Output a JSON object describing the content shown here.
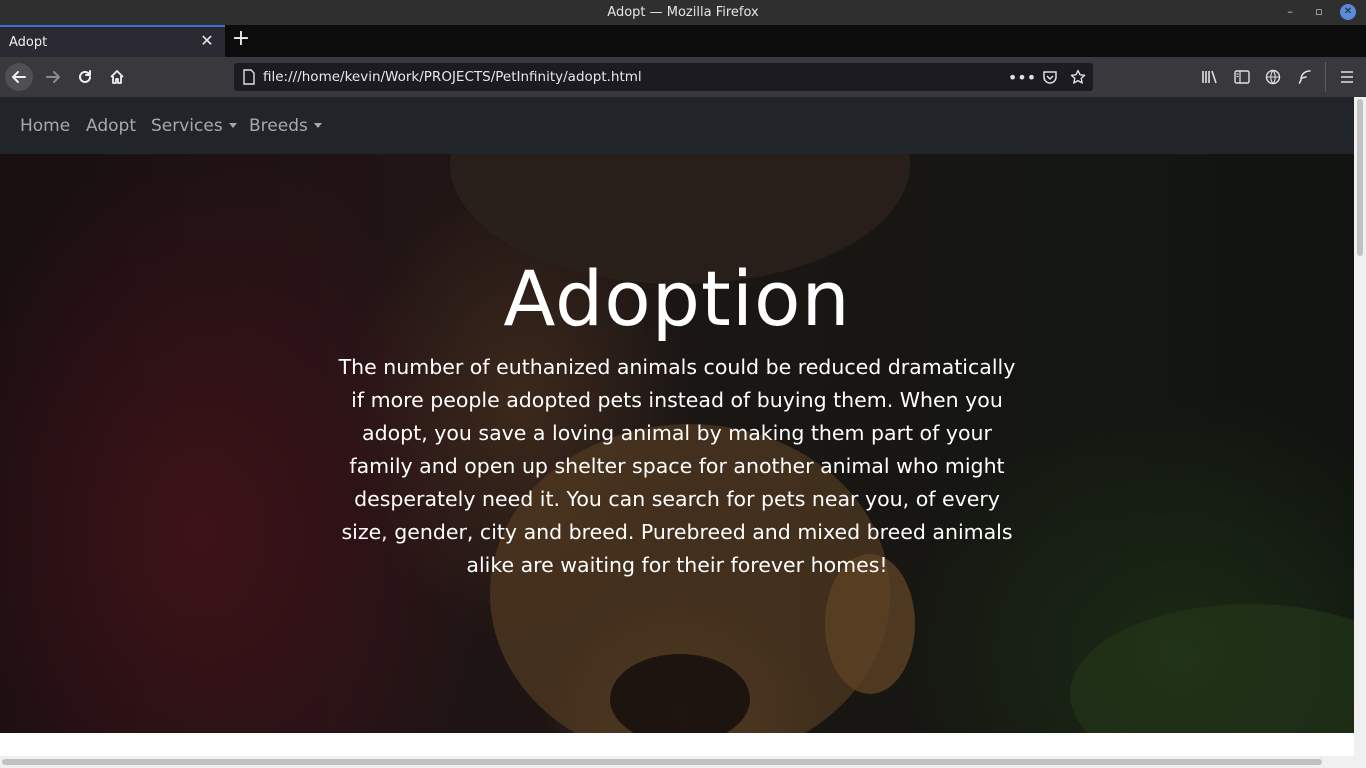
{
  "window": {
    "title": "Adopt — Mozilla Firefox"
  },
  "browser": {
    "tab": {
      "label": "Adopt",
      "close_glyph": "✕"
    },
    "new_tab_glyph": "+",
    "url": "file:///home/kevin/Work/PROJECTS/PetInfinity/adopt.html",
    "icons": {
      "back": "back-arrow-icon",
      "forward": "forward-arrow-icon",
      "reload": "reload-icon",
      "home": "home-icon",
      "page": "page-icon",
      "more": "more-actions-icon",
      "pocket": "pocket-icon",
      "bookmark": "bookmark-star-icon",
      "library": "library-icon",
      "sidebar": "sidebar-icon",
      "globe": "globe-icon",
      "extension": "feather-extension-icon",
      "menu": "hamburger-menu-icon"
    },
    "accent_color": "#3b6fd6"
  },
  "site": {
    "nav": {
      "items": [
        {
          "label": "Home",
          "dropdown": false
        },
        {
          "label": "Adopt",
          "dropdown": false
        },
        {
          "label": "Services",
          "dropdown": true
        },
        {
          "label": "Breeds",
          "dropdown": true
        }
      ],
      "background": "#212529"
    },
    "hero": {
      "heading": "Adoption",
      "body": "The number of euthanized animals could be reduced dramatically if more people adopted pets instead of buying them. When you adopt, you save a loving animal by making them part of your family and open up shelter space for another animal who might desperately need it. You can search for pets near you, of every size, gender, city and breed. Purebreed and mixed breed animals alike are waiting for their forever homes!"
    }
  }
}
